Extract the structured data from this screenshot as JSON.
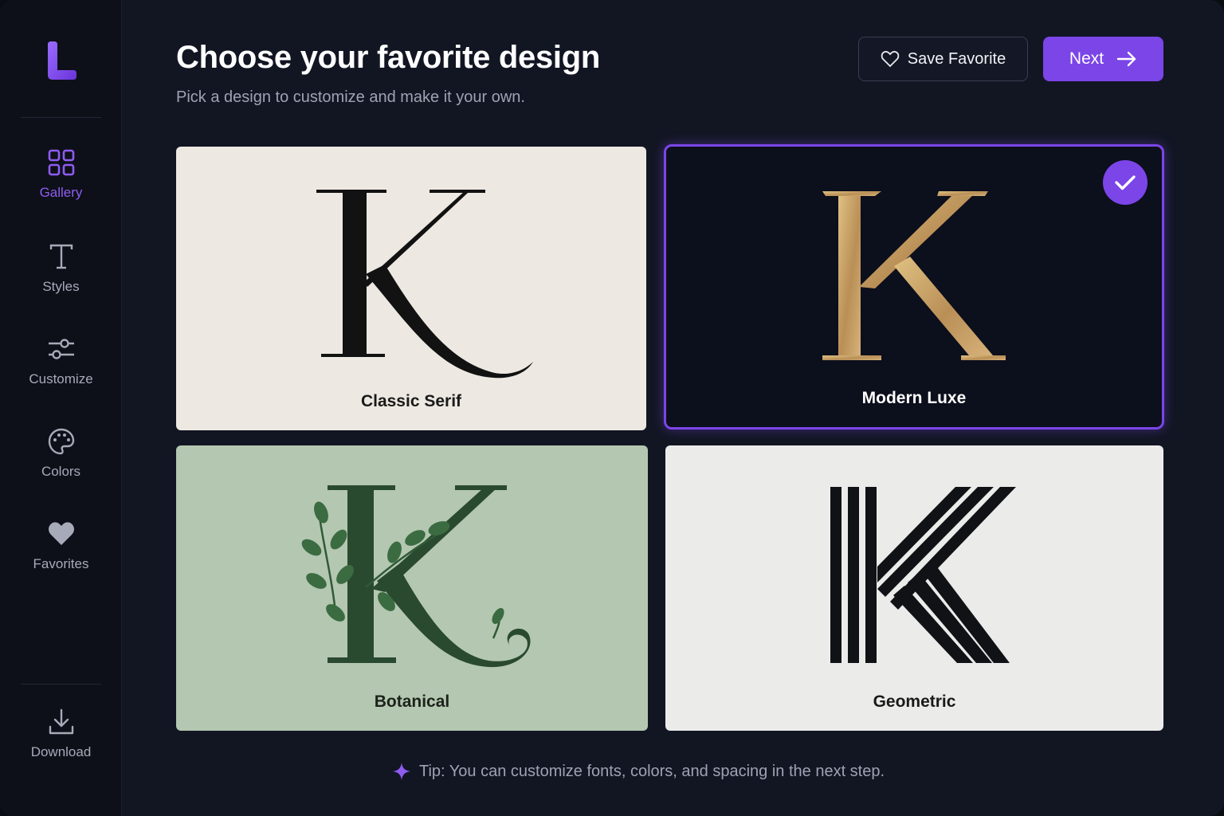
{
  "sidebar": {
    "logo_letter": "L",
    "items": [
      {
        "label": "Gallery",
        "icon": "grid-icon",
        "active": true
      },
      {
        "label": "Styles",
        "icon": "text-icon",
        "active": false
      },
      {
        "label": "Customize",
        "icon": "sliders-icon",
        "active": false
      },
      {
        "label": "Colors",
        "icon": "palette-icon",
        "active": false
      },
      {
        "label": "Favorites",
        "icon": "heart-icon",
        "active": false
      }
    ],
    "download": {
      "label": "Download",
      "icon": "download-icon"
    }
  },
  "header": {
    "title": "Choose your favorite design",
    "subtitle": "Pick a design to customize and make it your own.",
    "save_label": "Save Favorite",
    "next_label": "Next"
  },
  "designs": [
    {
      "name": "Classic Serif",
      "letter": "K",
      "background": "#ede9e2",
      "selected": false
    },
    {
      "name": "Modern Luxe",
      "letter": "K",
      "background": "#0c0f1c",
      "selected": true
    },
    {
      "name": "Botanical",
      "letter": "K",
      "background": "#b4c7b1",
      "selected": false
    },
    {
      "name": "Geometric",
      "letter": "K",
      "background": "#ebebea",
      "selected": false
    }
  ],
  "tip": "Tip: You can customize fonts, colors, and spacing in the next step.",
  "colors": {
    "accent": "#7b45e8",
    "background": "#121623",
    "sidebar": "#0d1019",
    "gold": "#c9a468"
  }
}
